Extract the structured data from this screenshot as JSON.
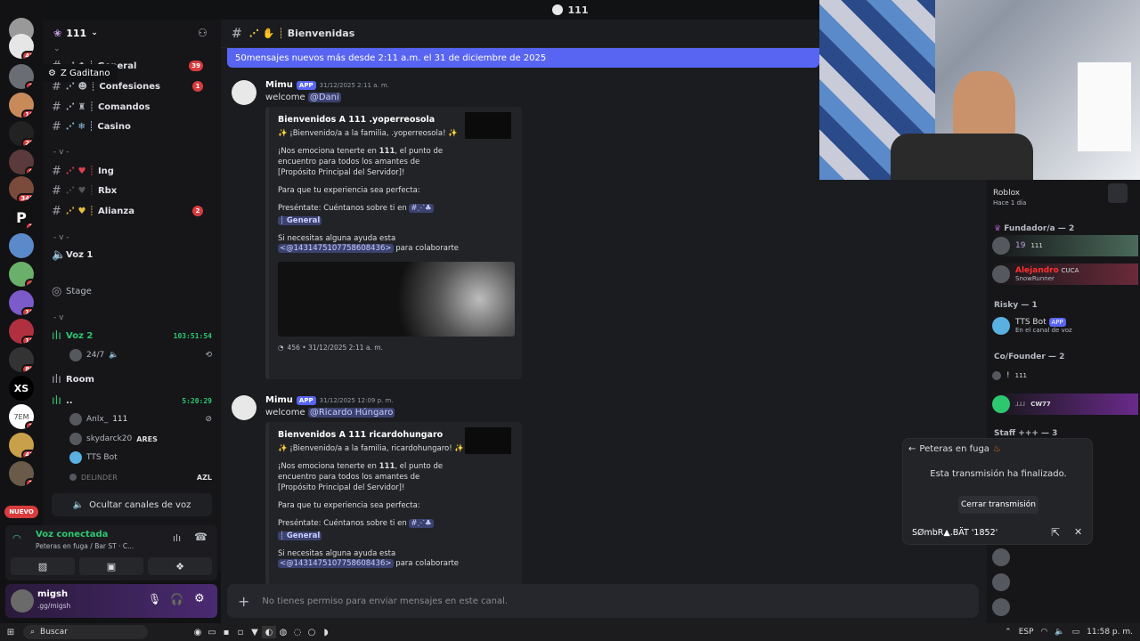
{
  "window": {
    "title": "111"
  },
  "tooltip": {
    "text": "Z Gaditano"
  },
  "server_rail": {
    "badges": [
      "48",
      "1",
      "16",
      "22",
      "6",
      "345",
      "3",
      "4",
      "19",
      "18",
      "80",
      "2",
      "47",
      "7"
    ],
    "nuevo_label": "NUEVO",
    "xs_label": "XS",
    "tem_label": "7EM"
  },
  "sidebar": {
    "server_name": "111",
    "channels": [
      {
        "name": "General",
        "badge": "39"
      },
      {
        "name": "Confesiones",
        "badge": "1"
      },
      {
        "name": "Comandos",
        "badge": ""
      },
      {
        "name": "Casino",
        "badge": ""
      },
      {
        "name": "Ing",
        "badge": ""
      },
      {
        "name": "Rbx",
        "badge": ""
      },
      {
        "name": "Alianza",
        "badge": "2"
      }
    ],
    "cat1": "- v -",
    "cat2": "- v -",
    "cat3": "- v",
    "voice": {
      "voz1": "Voz 1",
      "stage": "Stage",
      "voz2": "Voz 2",
      "voz2_time": "103:51:54",
      "voz2_user": "24/7",
      "room": "Room",
      "dots": "..",
      "dots_time": "5:20:29",
      "users": [
        {
          "name": "Anlx_",
          "tag": "111"
        },
        {
          "name": "skydarck20",
          "tag": "ARES"
        },
        {
          "name": "TTS Bot",
          "tag": ""
        },
        {
          "name": "DELINDER",
          "tag": "AZL"
        }
      ]
    },
    "hide_voice": "Ocultar canales de voz"
  },
  "voice_panel": {
    "status": "Voz conectada",
    "detail": "Peteras en fuga / Bar ST · C..."
  },
  "user_panel": {
    "name": "migsh",
    "status": ".gg/migsh"
  },
  "main": {
    "channel": "Bienvenidas",
    "new_messages": "50mensajes nuevos más desde 2:11 a.m. el 31 de diciembre de 2025",
    "messages": [
      {
        "author": "Mimu",
        "app": "APP",
        "time": "31/12/2025 2:11 a. m.",
        "text": "welcome",
        "mention": "@Dani",
        "embed_title": "Bienvenidos A 111 .yoperreosola",
        "line1": "✨ ¡Bienvenido/a a la familia, .yoperreosola! ✨",
        "line2a": "¡Nos emociona tenerte en ",
        "line2b": "111",
        "line2c": ", el punto de encuentro para todos los amantes de [Propósito Principal del Servidor]!",
        "line3": "Para que tu experiencia sea perfecta:",
        "line4": "Preséntate: Cuéntanos sobre ti en",
        "general": "General",
        "line5": "Si necesitas alguna ayuda esta",
        "role": "<@1431475107758608436>",
        "line5b": "para colaborarte",
        "footer": "456 • 31/12/2025 2:11 a. m."
      },
      {
        "author": "Mimu",
        "app": "APP",
        "time": "31/12/2025 12:09 p. m.",
        "text": "welcome",
        "mention": "@Ricardo Húngaro",
        "embed_title": "Bienvenidos A 111 ricardohungaro",
        "line1": "✨ ¡Bienvenido/a a la familia, ricardohungaro! ✨",
        "line2a": "¡Nos emociona tenerte en ",
        "line2b": "111",
        "line2c": ", el punto de encuentro para todos los amantes de [Propósito Principal del Servidor]!",
        "line3": "Para que tu experiencia sea perfecta:",
        "line4": "Preséntate: Cuéntanos sobre ti en",
        "general": "General",
        "line5": "Si necesitas alguna ayuda esta",
        "role": "<@1431475107758608436>",
        "line5b": "para colaborarte"
      }
    ],
    "input_placeholder": "No tienes permiso para enviar mensajes en este canal."
  },
  "members": {
    "roblox_name": "Roblox",
    "roblox_sub": "Hace 1 día",
    "groups": [
      {
        "title": "Fundador/a — 2"
      },
      {
        "title": "Risky — 1"
      },
      {
        "title": "Co/Founder — 2"
      },
      {
        "title": "Staff +++ — 3"
      }
    ],
    "rows": [
      {
        "name": "19",
        "tag": "111",
        "sub": ""
      },
      {
        "name": "Alejandro",
        "tag": "CUCA",
        "sub": "SnowRunner"
      },
      {
        "name": "TTS Bot",
        "tag": "APP",
        "sub": "En el canal de voz"
      },
      {
        "name": "!",
        "tag": "111",
        "sub": ""
      },
      {
        "name": "ɹɹɹ",
        "tag": "CW77",
        "sub": ""
      }
    ]
  },
  "stream_popup": {
    "title": "Peteras en fuga",
    "message": "Esta transmisión ha finalizado.",
    "button": "Cerrar transmisión",
    "streamer": "SØmbR▲.BÄT '1852'"
  },
  "taskbar": {
    "search": "Buscar",
    "lang": "ESP",
    "time": "11:58 p. m."
  }
}
